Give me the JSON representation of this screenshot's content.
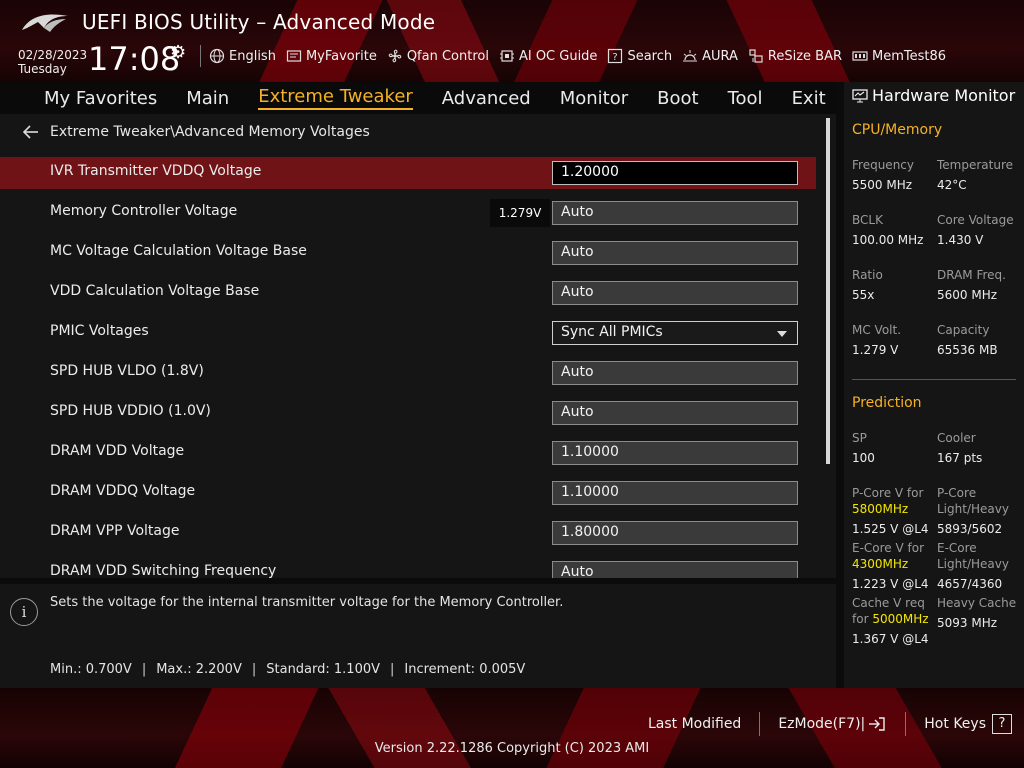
{
  "header": {
    "title": "UEFI BIOS Utility – Advanced Mode",
    "date": "02/28/2023",
    "day": "Tuesday",
    "time": "17:08",
    "tools": [
      {
        "label": "English",
        "icon": "globe-icon"
      },
      {
        "label": "MyFavorite",
        "icon": "favorite-icon"
      },
      {
        "label": "Qfan Control",
        "icon": "fan-icon"
      },
      {
        "label": "AI OC Guide",
        "icon": "oc-guide-icon"
      },
      {
        "label": "Search",
        "icon": "search-icon"
      },
      {
        "label": "AURA",
        "icon": "aura-icon"
      },
      {
        "label": "ReSize BAR",
        "icon": "resize-bar-icon"
      },
      {
        "label": "MemTest86",
        "icon": "memtest-icon"
      }
    ]
  },
  "menu": {
    "items": [
      "My Favorites",
      "Main",
      "Extreme Tweaker",
      "Advanced",
      "Monitor",
      "Boot",
      "Tool",
      "Exit"
    ],
    "active": "Extreme Tweaker"
  },
  "breadcrumb": "Extreme Tweaker\\Advanced Memory Voltages",
  "settings": [
    {
      "label": "IVR Transmitter VDDQ Voltage",
      "value": "1.20000"
    },
    {
      "label": "Memory Controller Voltage",
      "value": "Auto",
      "readout": "1.279V"
    },
    {
      "label": "MC Voltage Calculation Voltage Base",
      "value": "Auto"
    },
    {
      "label": "VDD Calculation Voltage Base",
      "value": "Auto"
    },
    {
      "label": "PMIC Voltages",
      "value": "Sync All PMICs"
    },
    {
      "label": "SPD HUB VLDO (1.8V)",
      "value": "Auto"
    },
    {
      "label": "SPD HUB VDDIO (1.0V)",
      "value": "Auto"
    },
    {
      "label": "DRAM VDD Voltage",
      "value": "1.10000"
    },
    {
      "label": "DRAM VDDQ Voltage",
      "value": "1.10000"
    },
    {
      "label": "DRAM VPP Voltage",
      "value": "1.80000"
    },
    {
      "label": "DRAM VDD Switching Frequency",
      "value": "Auto"
    }
  ],
  "help": {
    "description": "Sets the voltage for the internal transmitter voltage for the Memory Controller.",
    "min": "Min.: 0.700V",
    "max": "Max.: 2.200V",
    "standard": "Standard: 1.100V",
    "increment": "Increment: 0.005V"
  },
  "hwmon": {
    "title": "Hardware Monitor",
    "cpu_section": "CPU/Memory",
    "frequency_label": "Frequency",
    "frequency_value": "5500 MHz",
    "temperature_label": "Temperature",
    "temperature_value": "42°C",
    "bclk_label": "BCLK",
    "bclk_value": "100.00 MHz",
    "core_voltage_label": "Core Voltage",
    "core_voltage_value": "1.430 V",
    "ratio_label": "Ratio",
    "ratio_value": "55x",
    "dram_freq_label": "DRAM Freq.",
    "dram_freq_value": "5600 MHz",
    "mc_volt_label": "MC Volt.",
    "mc_volt_value": "1.279 V",
    "capacity_label": "Capacity",
    "capacity_value": "65536 MB",
    "prediction_section": "Prediction",
    "sp_label": "SP",
    "sp_value": "100",
    "cooler_label": "Cooler",
    "cooler_value": "167 pts",
    "pcore_v_label": "P-Core V for",
    "pcore_v_freq": "5800MHz",
    "pcore_v_value": "1.525 V @L4",
    "pcore_lh_label1": "P-Core",
    "pcore_lh_label2": "Light/Heavy",
    "pcore_lh_value": "5893/5602",
    "ecore_v_label": "E-Core V for",
    "ecore_v_freq": "4300MHz",
    "ecore_v_value": "1.223 V @L4",
    "ecore_lh_label1": "E-Core",
    "ecore_lh_label2": "Light/Heavy",
    "ecore_lh_value": "4657/4360",
    "cache_v_label1": "Cache V req",
    "cache_v_label2": "for",
    "cache_v_freq": "5000MHz",
    "cache_v_value": "1.367 V @L4",
    "heavy_cache_label": "Heavy Cache",
    "heavy_cache_value": "5093 MHz"
  },
  "footer": {
    "last_modified": "Last Modified",
    "ezmode": "EzMode(F7)|",
    "hot_keys": "Hot Keys",
    "hot_keys_key": "?",
    "version": "Version 2.22.1286 Copyright (C) 2023 AMI"
  },
  "colors": {
    "accent": "#f5b227",
    "selected_row": "#6f1316",
    "highlight": "#f2e600"
  }
}
